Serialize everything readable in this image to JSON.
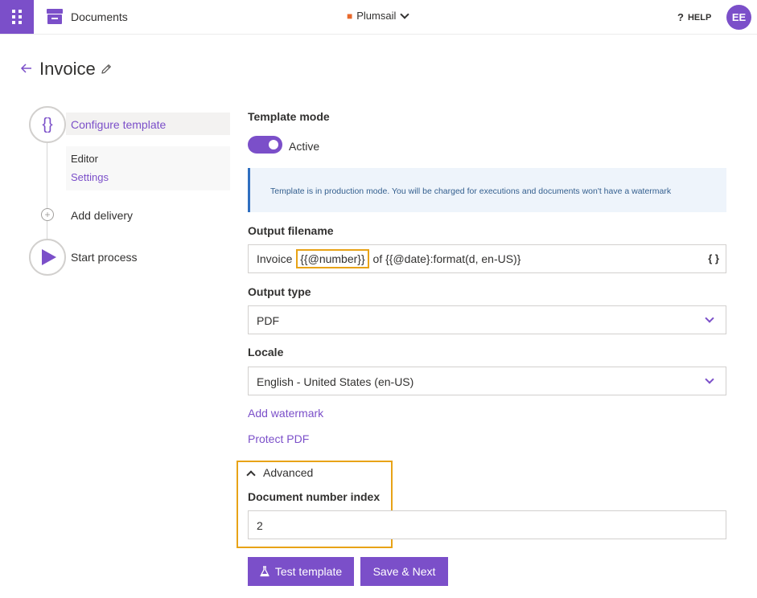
{
  "header": {
    "app_name": "Documents",
    "tenant": "Plumsail",
    "help_label": "HELP",
    "avatar_initials": "EE",
    "accent_color": "#7b4fc9"
  },
  "page": {
    "title": "Invoice"
  },
  "stepper": {
    "step1_icon": "{}",
    "step1_label": "Configure template",
    "substep_editor": "Editor",
    "substep_settings": "Settings",
    "step2_label": "Add delivery",
    "step3_label": "Start process"
  },
  "form": {
    "template_mode_label": "Template mode",
    "template_mode_state": "Active",
    "info_message": "Template is in production mode. You will be charged for executions and documents won't have a watermark",
    "output_filename_label": "Output filename",
    "output_filename_prefix": "Invoice ",
    "output_filename_token": "{{@number}}",
    "output_filename_suffix": " of {{@date}:format(d, en-US)}",
    "output_type_label": "Output type",
    "output_type_value": "PDF",
    "locale_label": "Locale",
    "locale_value": "English - United States (en-US)",
    "add_watermark_link": "Add watermark",
    "protect_pdf_link": "Protect PDF",
    "advanced_label": "Advanced",
    "document_number_index_label": "Document number index",
    "document_number_index_value": "2"
  },
  "actions": {
    "test_template_label": "Test template",
    "save_next_label": "Save & Next"
  },
  "highlight_color": "#e8a317"
}
